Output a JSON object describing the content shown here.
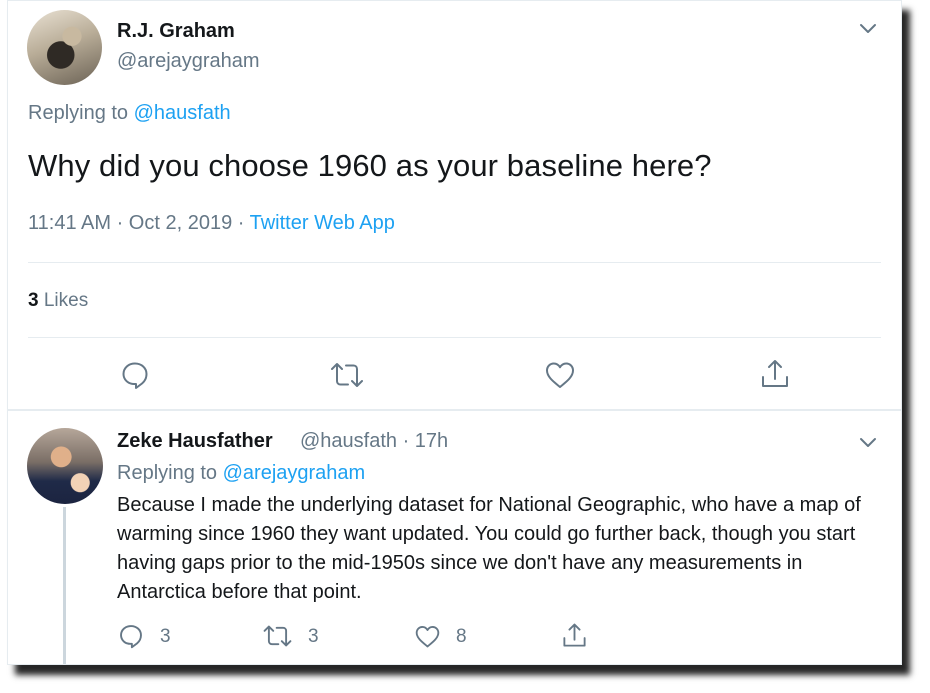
{
  "main_tweet": {
    "author_name": "R.J. Graham",
    "author_handle": "@arejaygraham",
    "replying_to_prefix": "Replying to ",
    "replying_to": "@hausfath",
    "text": "Why did you choose 1960 as your baseline here?",
    "timestamp": "11:41 AM · Oct 2, 2019 · ",
    "source": "Twitter Web App",
    "likes_count": "3",
    "likes_label": " Likes"
  },
  "reply_tweet": {
    "author_name": "Zeke Hausfather",
    "author_handle": "@hausfath · 17h",
    "replying_to_prefix": "Replying to ",
    "replying_to": "@arejaygraham",
    "text": "Because I made the underlying dataset for National Geographic, who have a map of warming since 1960 they want updated. You could go further back, though you start having gaps prior to the mid-1950s since we don't have any measurements in Antarctica before that point.",
    "reply_count": "3",
    "retweet_count": "3",
    "like_count": "8"
  },
  "icons": [
    "chevron-down-icon",
    "reply-icon",
    "retweet-icon",
    "like-icon",
    "share-icon"
  ],
  "colors": {
    "link": "#1da1f2",
    "muted": "#657786",
    "text": "#14171a",
    "divider": "#e6ecf0"
  }
}
